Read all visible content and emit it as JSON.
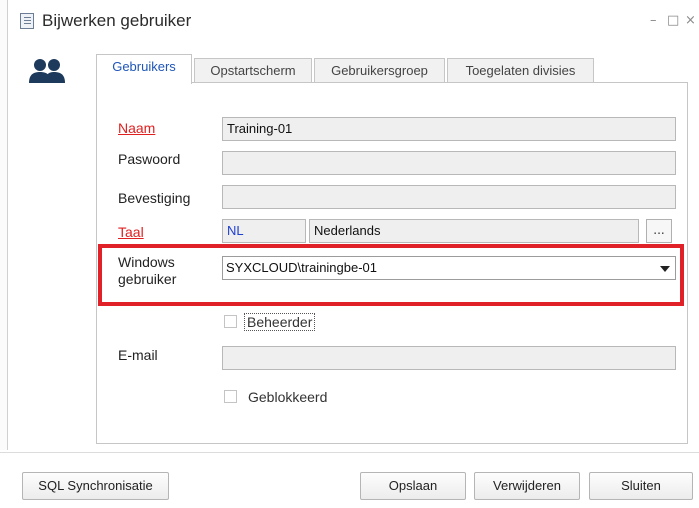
{
  "window": {
    "title": "Bijwerken gebruiker",
    "controls": {
      "minimize": "–",
      "maximize": "□",
      "close": "×"
    }
  },
  "icons": {
    "title": "document-icon",
    "users": "users-icon"
  },
  "tabs": [
    {
      "label": "Gebruikers",
      "active": true
    },
    {
      "label": "Opstartscherm",
      "active": false
    },
    {
      "label": "Gebruikersgroep",
      "active": false
    },
    {
      "label": "Toegelaten divisies",
      "active": false
    }
  ],
  "form": {
    "naam": {
      "label": "Naam",
      "value": "Training-01"
    },
    "paswoord": {
      "label": "Paswoord",
      "value": ""
    },
    "bevestiging": {
      "label": "Bevestiging",
      "value": ""
    },
    "taal": {
      "label": "Taal",
      "code": "NL",
      "name": "Nederlands",
      "browse": "..."
    },
    "windows_user": {
      "label_line1": "Windows",
      "label_line2": "gebruiker",
      "value": "SYXCLOUD\\trainingbe-01"
    },
    "beheerder": {
      "label": "Beheerder",
      "checked": false
    },
    "email": {
      "label": "E-mail",
      "value": ""
    },
    "geblokkeerd": {
      "label": "Geblokkeerd",
      "checked": false
    }
  },
  "buttons": {
    "sql_sync": "SQL Synchronisatie",
    "save": "Opslaan",
    "delete": "Verwijderen",
    "close": "Sluiten"
  },
  "colors": {
    "required_label": "#e02020",
    "highlight_border": "#e02127",
    "active_tab_text": "#1f56b8",
    "lang_code": "#1f3fd0"
  }
}
